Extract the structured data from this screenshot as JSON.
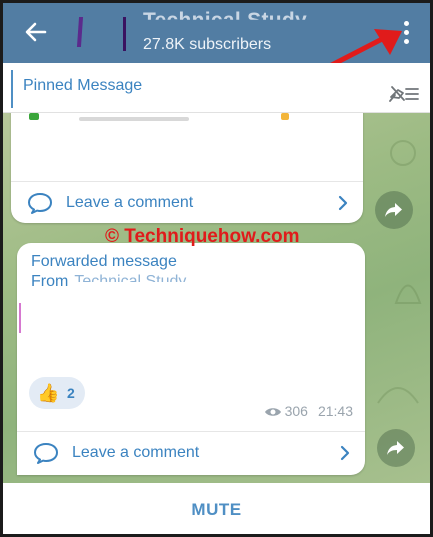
{
  "header": {
    "title": "Technical Study",
    "subscribers": "27.8K subscribers",
    "icons": {
      "back": "arrow-left-icon",
      "menu": "more-vert-icon"
    }
  },
  "pinned": {
    "label": "Pinned Message",
    "icon": "unpin-list-icon"
  },
  "messages": [
    {
      "comment_label": "Leave a comment"
    },
    {
      "forwarded_label": "Forwarded message",
      "from_label": "From",
      "from_name": "Technical Study",
      "reaction_emoji": "👍",
      "reaction_count": "2",
      "views": "306",
      "time": "21:43",
      "comment_label": "Leave a comment"
    }
  ],
  "watermark": "© Techniquehow.com",
  "bottom": {
    "mute_label": "MUTE"
  },
  "colors": {
    "header_bg": "#527da3",
    "accent_blue": "#3b83c0",
    "annotation_red": "#e01b1b"
  }
}
